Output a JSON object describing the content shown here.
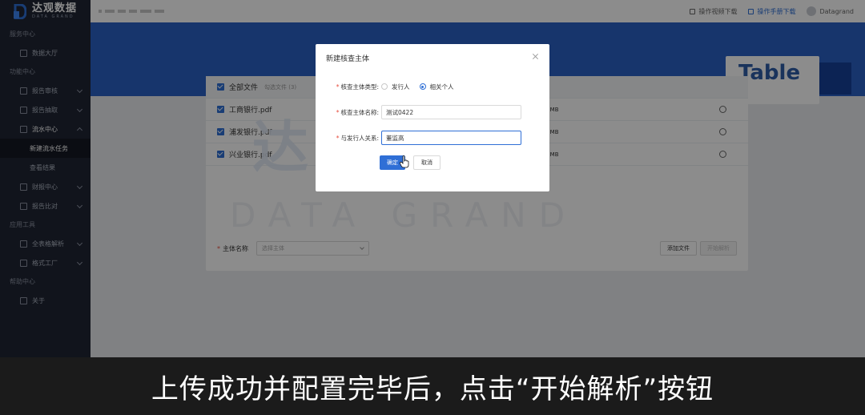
{
  "logo": {
    "cn": "达观数据",
    "en": "DATA GRAND"
  },
  "sidebar": {
    "sections": [
      {
        "label": "服务中心",
        "items": [
          {
            "label": "数据大厅"
          }
        ]
      },
      {
        "label": "功能中心",
        "items": [
          {
            "label": "报告审核"
          },
          {
            "label": "报告抽取"
          },
          {
            "label": "流水中心",
            "expanded": true
          },
          {
            "label": "新建流水任务",
            "sub": true,
            "active": true
          },
          {
            "label": "查看结果",
            "sub": true
          },
          {
            "label": "财报中心"
          },
          {
            "label": "报告比对"
          }
        ]
      },
      {
        "label": "应用工具",
        "items": [
          {
            "label": "全表格解析"
          },
          {
            "label": "格式工厂"
          }
        ]
      },
      {
        "label": "帮助中心",
        "items": [
          {
            "label": "关于"
          }
        ]
      }
    ]
  },
  "topbar": {
    "video_link": "操作视频下载",
    "manual_link": "操作手册下载",
    "username": "Datagrand"
  },
  "banner": {
    "card_text": "Table"
  },
  "files": {
    "header_label": "全部文件",
    "header_hint": "勾选文件 (3)",
    "rows": [
      {
        "name": "工商银行.pdf",
        "size": "2 MB"
      },
      {
        "name": "浦发银行.pdf",
        "size": "3 MB"
      },
      {
        "name": "兴业银行.pdf",
        "size": "3 MB"
      }
    ]
  },
  "watermark": {
    "cn": "达观数据",
    "en": "DATA GRAND"
  },
  "bottom_bar": {
    "subject_label": "主体名称",
    "subject_placeholder": "选择主体",
    "add_file": "添加文件",
    "start_parse": "开始解析"
  },
  "modal": {
    "title": "新建核查主体",
    "type_label": "核查主体类型:",
    "type_options": [
      "发行人",
      "相关个人"
    ],
    "name_label": "核查主体名称:",
    "name_value": "测试0422",
    "relation_label": "与发行人关系:",
    "relation_value": "董监高",
    "ok": "确定",
    "cancel": "取消"
  },
  "caption": {
    "text": "上传成功并配置完毕后，点击“开始解析”按钮"
  },
  "colors": {
    "accent": "#2f6fd6",
    "sidebar": "#1f2533",
    "banner": "#2a61c5"
  }
}
